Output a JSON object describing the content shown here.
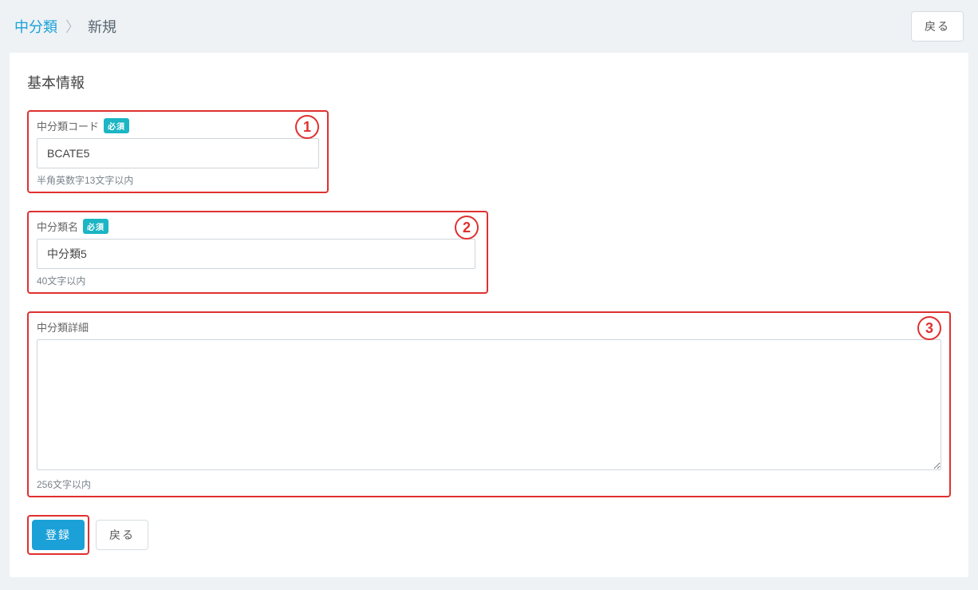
{
  "breadcrumb": {
    "parent": "中分類",
    "separator": "〉",
    "current": "新規"
  },
  "header": {
    "back_label": "戻る"
  },
  "section": {
    "title": "基本情報"
  },
  "fields": {
    "code": {
      "label": "中分類コード",
      "required_badge": "必須",
      "value": "BCATE5",
      "hint": "半角英数字13文字以内",
      "callout": "1"
    },
    "name": {
      "label": "中分類名",
      "required_badge": "必須",
      "value": "中分類5",
      "hint": "40文字以内",
      "callout": "2"
    },
    "detail": {
      "label": "中分類詳細",
      "value": "",
      "hint": "256文字以内",
      "callout": "3"
    }
  },
  "actions": {
    "submit_label": "登録",
    "back_label": "戻る"
  }
}
